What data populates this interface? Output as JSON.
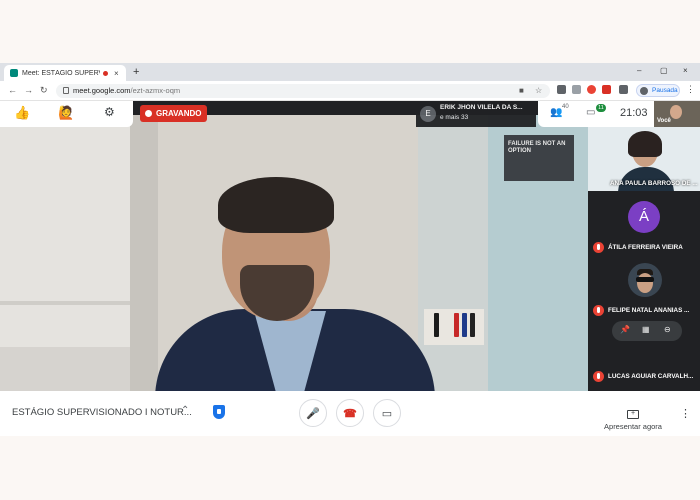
{
  "browser": {
    "tab_title": "Meet: ESTÁGIO SUPERVISIONADO",
    "tab_close": "×",
    "new_tab": "+",
    "window_controls": [
      "–",
      "▢",
      "×"
    ],
    "url_host": "meet.google.com",
    "url_path": "/ezt-azmx-oqm",
    "profile_label": "Pausada"
  },
  "meet": {
    "recording_label": "GRAVANDO",
    "presenter_initial": "E",
    "presenter_name": "ERIK JHON VILELA DA S...",
    "presenter_more": "e mais 33",
    "people_count": "40",
    "chat_count": "11",
    "clock": "21:03",
    "self_label": "Você",
    "poster_text": "FAILURE IS NOT AN OPTION",
    "participants": [
      {
        "name": "ANA PAULA BARROSO DE ..."
      },
      {
        "name": "ÁTILA FERREIRA VIEIRA",
        "initial": "Á"
      },
      {
        "name": "FELIPE NATAL ANANIAS ..."
      },
      {
        "name": "LUCAS AGUIAR CARVALH..."
      }
    ],
    "meeting_title": "ESTÁGIO SUPERVISIONADO I NOTUR...",
    "present_label": "Apresentar agora"
  },
  "colors": {
    "recording_red": "#d93025",
    "meet_dark": "#202124",
    "accent_blue": "#1a73e8",
    "avatar_purple": "#7b3fc4"
  },
  "icons": [
    "thumbs-up-icon",
    "raise-hand-icon",
    "gear-icon",
    "people-icon",
    "chat-icon",
    "mic-icon",
    "end-call-icon",
    "camera-icon",
    "present-icon",
    "more-icon",
    "shield-icon"
  ]
}
